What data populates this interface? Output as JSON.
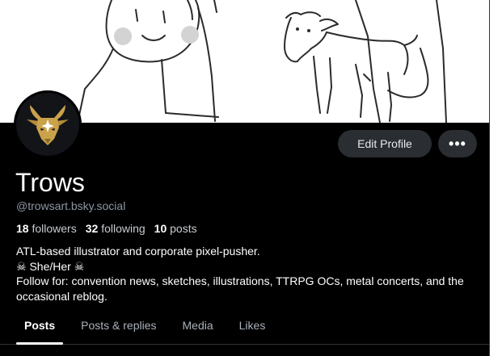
{
  "profile": {
    "display_name": "Trows",
    "handle": "@trowsart.bsky.social",
    "stats": {
      "followers_count": "18",
      "followers_label": "followers",
      "following_count": "32",
      "following_label": "following",
      "posts_count": "10",
      "posts_label": "posts"
    },
    "bio": {
      "line1": "ATL-based illustrator and corporate pixel-pusher.",
      "line2": "☠ She/Her ☠",
      "line3": "Follow for: convention news, sketches, illustrations, TTRPG OCs, metal concerts, and the occasional reblog."
    }
  },
  "actions": {
    "edit_profile_label": "Edit Profile",
    "more_label": "•••"
  },
  "tabs": [
    {
      "label": "Posts",
      "active": true
    },
    {
      "label": "Posts & replies",
      "active": false
    },
    {
      "label": "Media",
      "active": false
    },
    {
      "label": "Likes",
      "active": false
    }
  ],
  "icons": {
    "avatar": "goat-emblem-avatar",
    "more": "more-horizontal-icon"
  },
  "colors": {
    "background": "#000000",
    "button": "#2a2d31",
    "muted_text": "#8d97a3",
    "avatar_gold": "#c9a24a"
  }
}
